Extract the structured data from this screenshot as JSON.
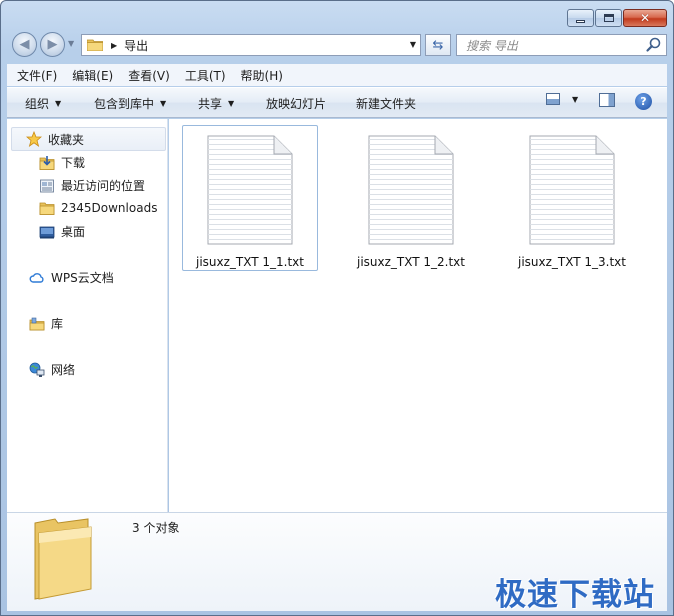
{
  "window": {
    "caption_buttons": {
      "minimize": "minimize",
      "maximize": "maximize",
      "close": "close"
    }
  },
  "address": {
    "path": "导出",
    "search_placeholder": "搜索 导出"
  },
  "menubar": {
    "items": [
      "文件(F)",
      "编辑(E)",
      "查看(V)",
      "工具(T)",
      "帮助(H)"
    ]
  },
  "toolbar": {
    "organize": "组织",
    "include_in_library": "包含到库中",
    "share": "共享",
    "slideshow": "放映幻灯片",
    "new_folder": "新建文件夹"
  },
  "sidebar": {
    "favorites": "收藏夹",
    "items": [
      "下载",
      "最近访问的位置",
      "2345Downloads",
      "桌面"
    ],
    "wps": "WPS云文档",
    "library": "库",
    "network": "网络"
  },
  "files": [
    {
      "name": "jisuxz_TXT 1_1.txt",
      "selected": true
    },
    {
      "name": "jisuxz_TXT 1_2.txt",
      "selected": false
    },
    {
      "name": "jisuxz_TXT 1_3.txt",
      "selected": false
    }
  ],
  "details": {
    "count": "3 个对象"
  },
  "watermark": "极速下载站",
  "colors": {
    "accent": "#2f6bc4",
    "selection_border": "#99b9dd",
    "frame": "#a9c3e2"
  }
}
